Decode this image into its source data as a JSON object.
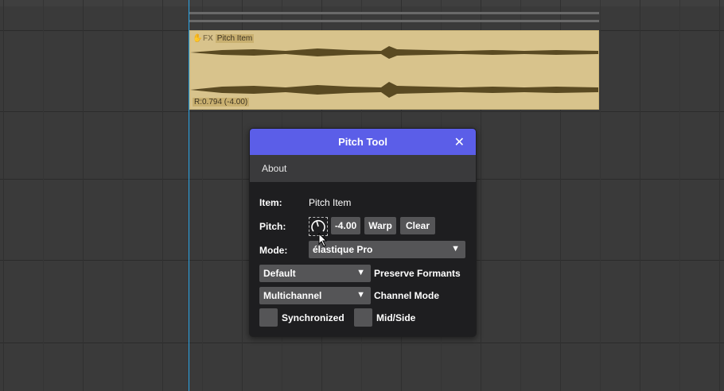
{
  "item": {
    "fx_label": "FX",
    "name": "Pitch Item",
    "rate": "R:0.794 (-4.00)",
    "lock_icon": "lock-icon"
  },
  "dialog": {
    "title": "Pitch Tool",
    "close_icon": "close-icon",
    "menu": {
      "about": "About"
    },
    "item_label": "Item:",
    "item_value": "Pitch Item",
    "pitch_label": "Pitch:",
    "pitch_value": "-4.00",
    "warp_label": "Warp",
    "clear_label": "Clear",
    "mode_label": "Mode:",
    "mode_value": "élastique Pro",
    "formant_value": "Default",
    "formant_label": "Preserve Formants",
    "channel_value": "Multichannel",
    "channel_label": "Channel Mode",
    "synchronized_label": "Synchronized",
    "midside_label": "Mid/Side"
  },
  "colors": {
    "titlebar": "#5b5ee8",
    "item_background": "#d8c38c",
    "waveform": "#5a4a22",
    "cursor_line": "#2aa6e8"
  }
}
